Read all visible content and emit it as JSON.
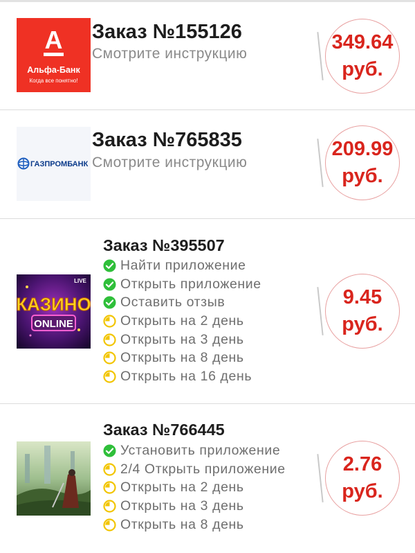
{
  "orders": [
    {
      "title": "Заказ №155126",
      "subtitle": "Смотрите инструкцию",
      "price_value": "349.64",
      "price_unit": "руб.",
      "logo": {
        "brand_text": "Альфа-Банк",
        "tagline": "Когда все понятно!",
        "color": "#ef3124"
      }
    },
    {
      "title": "Заказ №765835",
      "subtitle": "Смотрите инструкцию",
      "price_value": "209.99",
      "price_unit": "руб.",
      "logo": {
        "brand_text": "ГАЗПРОМБАНК",
        "color": "#0a3a8a"
      }
    },
    {
      "title": "Заказ №395507",
      "price_value": "9.45",
      "price_unit": "руб.",
      "logo": {
        "main_text": "КАЗИНО",
        "badge_text": "ONLINE",
        "corner_text": "LIVE"
      },
      "tasks": [
        {
          "label": "Найти приложение",
          "status": "done"
        },
        {
          "label": "Открыть приложение",
          "status": "done"
        },
        {
          "label": "Оставить отзыв",
          "status": "done"
        },
        {
          "label": "Открыть на 2 день",
          "status": "pending"
        },
        {
          "label": "Открыть на 3 день",
          "status": "pending"
        },
        {
          "label": "Открыть на 8 день",
          "status": "pending"
        },
        {
          "label": "Открыть на 16 день",
          "status": "pending"
        }
      ]
    },
    {
      "title": "Заказ №766445",
      "price_value": "2.76",
      "price_unit": "руб.",
      "logo": {
        "icon": "fantasy-game-icon"
      },
      "tasks": [
        {
          "label": "Установить приложение",
          "status": "done"
        },
        {
          "label": "2/4 Открыть приложение",
          "status": "pending"
        },
        {
          "label": "Открыть на 2 день",
          "status": "pending"
        },
        {
          "label": "Открыть на 3 день",
          "status": "pending"
        },
        {
          "label": "Открыть на 8 день",
          "status": "pending"
        }
      ]
    }
  ],
  "colors": {
    "price_red": "#d9251d",
    "done_green": "#2fbf3a",
    "pending_yellow": "#f2c500",
    "title": "#1d1d1d",
    "muted": "#8a8a8a"
  }
}
